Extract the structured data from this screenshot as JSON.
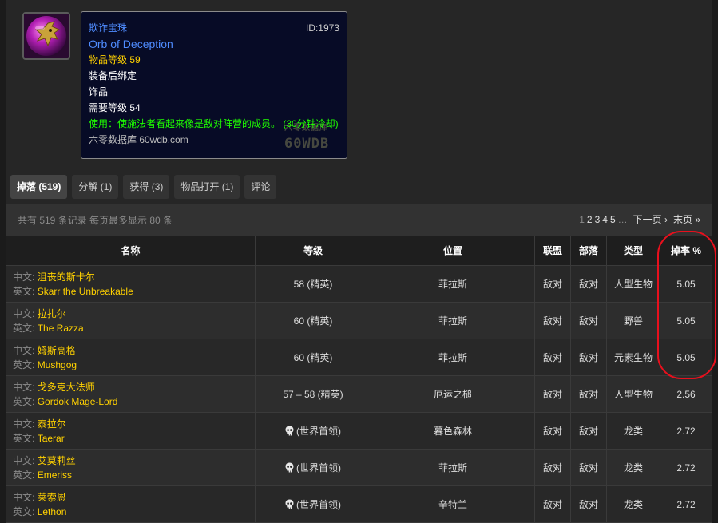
{
  "item": {
    "icon": "orb-of-deception-icon",
    "name_cn": "欺诈宝珠",
    "name_en": "Orb of Deception",
    "id_text": "ID:1973",
    "item_level": "物品等级 59",
    "binding": "装备后绑定",
    "slot": "饰品",
    "required_level": "需要等级 54",
    "use_text": "使用：使施法者看起来像是敌对阵营的成员。 (30分钟冷却)",
    "source": "六零数据库 60wdb.com",
    "watermark_small": "六零数据库",
    "watermark_big": "60WDB"
  },
  "tabs": [
    {
      "label": "掉落 (519)",
      "active": true
    },
    {
      "label": "分解 (1)"
    },
    {
      "label": "获得 (3)"
    },
    {
      "label": "物品打开 (1)"
    },
    {
      "label": "评论"
    }
  ],
  "info": {
    "summary": "共有 519 条记录 每页最多显示 80 条",
    "current_page": "1",
    "pages": [
      "2",
      "3",
      "4",
      "5"
    ],
    "ellipsis": "…",
    "next": "下一页 ›",
    "last": "末页 »"
  },
  "table": {
    "headers": [
      "名称",
      "等级",
      "位置",
      "联盟",
      "部落",
      "类型",
      "掉率 %"
    ],
    "cn_label": "中文:",
    "en_label": "英文:",
    "rows": [
      {
        "cn": "沮丧的斯卡尔",
        "en": "Skarr the Unbreakable",
        "level": "58 (精英)",
        "skull": false,
        "zone": "菲拉斯",
        "alliance": "敌对",
        "horde": "敌对",
        "type": "人型生物",
        "rate": "5.05"
      },
      {
        "cn": "拉扎尔",
        "en": "The Razza",
        "level": "60 (精英)",
        "skull": false,
        "zone": "菲拉斯",
        "alliance": "敌对",
        "horde": "敌对",
        "type": "野兽",
        "rate": "5.05"
      },
      {
        "cn": "姆斯高格",
        "en": "Mushgog",
        "level": "60 (精英)",
        "skull": false,
        "zone": "菲拉斯",
        "alliance": "敌对",
        "horde": "敌对",
        "type": "元素生物",
        "rate": "5.05"
      },
      {
        "cn": "戈多克大法师",
        "en": "Gordok Mage-Lord",
        "level": "57 – 58 (精英)",
        "skull": false,
        "zone": "厄运之槌",
        "alliance": "敌对",
        "horde": "敌对",
        "type": "人型生物",
        "rate": "2.56"
      },
      {
        "cn": "泰拉尔",
        "en": "Taerar",
        "level": "(世界首领)",
        "skull": true,
        "zone": "暮色森林",
        "alliance": "敌对",
        "horde": "敌对",
        "type": "龙类",
        "rate": "2.72"
      },
      {
        "cn": "艾莫莉丝",
        "en": "Emeriss",
        "level": "(世界首领)",
        "skull": true,
        "zone": "菲拉斯",
        "alliance": "敌对",
        "horde": "敌对",
        "type": "龙类",
        "rate": "2.72"
      },
      {
        "cn": "莱索恩",
        "en": "Lethon",
        "level": "(世界首领)",
        "skull": true,
        "zone": "辛特兰",
        "alliance": "敌对",
        "horde": "敌对",
        "type": "龙类",
        "rate": "2.72"
      }
    ]
  },
  "colors": {
    "item_name": "#4f8cff",
    "item_level": "#ffd100",
    "use_effect": "#1eff00",
    "npc_name": "#ffd100",
    "hostile": "#ff2020",
    "highlight": "#e8101d"
  }
}
